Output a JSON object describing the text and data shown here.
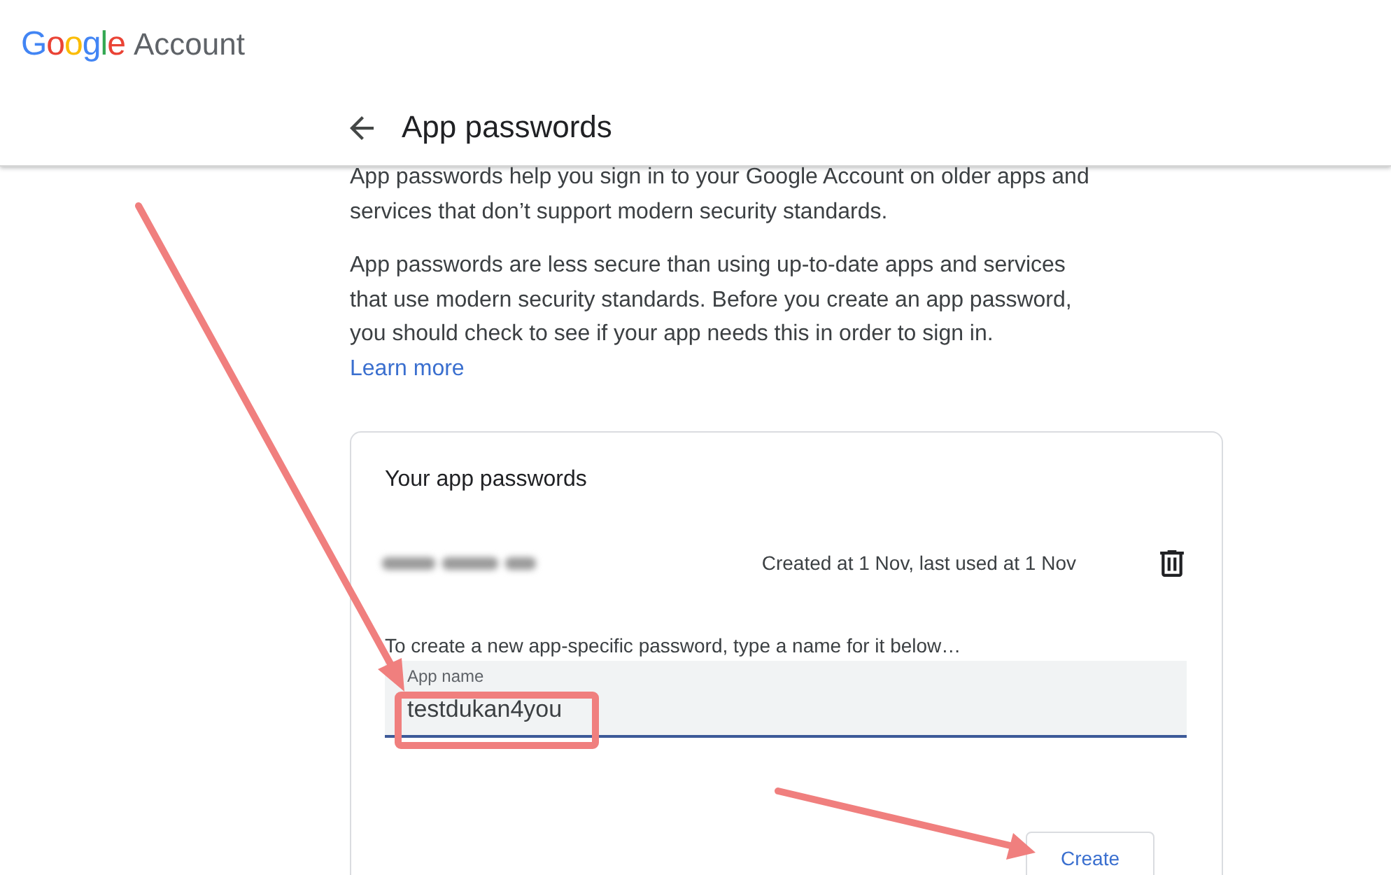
{
  "header": {
    "logo": "Google",
    "product": "Account"
  },
  "page": {
    "title": "App passwords"
  },
  "intro": [
    "App passwords help you sign in to your Google Account on older apps and services that don’t support modern security standards.",
    "App passwords are less secure than using up-to-date apps and services that use modern security standards. Before you create an app password, you should check to see if your app needs this in order to sign in."
  ],
  "learn_more": "Learn more",
  "card": {
    "title": "Your app passwords",
    "passwords": [
      {
        "usage": "Created at 1 Nov, last used at 1 Nov"
      }
    ],
    "instruction": "To create a new app-specific password, type a name for it below…",
    "field": {
      "label": "App name",
      "value": "testdukan4you",
      "focused": true
    },
    "button": "Create"
  }
}
